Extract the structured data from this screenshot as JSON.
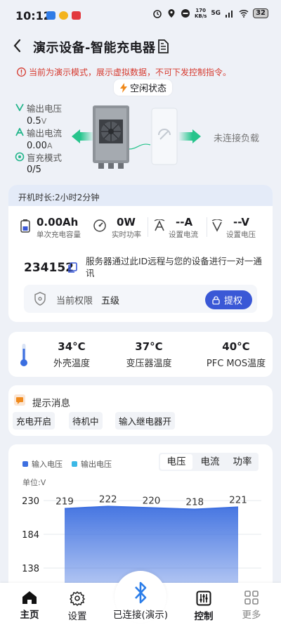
{
  "status_bar": {
    "time": "10:12",
    "net_speed": "170",
    "net_unit": "KB/s",
    "net_type": "5G",
    "battery": "32"
  },
  "header": {
    "title": "演示设备-智能充电器"
  },
  "notice": {
    "text": "当前为演示模式，展示虚拟数据，不可下发控制指令。",
    "state": "空闲状态"
  },
  "device": {
    "metrics": [
      {
        "label": "输出电压",
        "value": "0.5",
        "unit": "V"
      },
      {
        "label": "输出电流",
        "value": "0.00",
        "unit": "A"
      },
      {
        "label": "盲充模式",
        "value": "0/5",
        "unit": ""
      }
    ],
    "load_status": "未连接负载"
  },
  "info": {
    "runtime": "开机时长:2小时2分钟",
    "stats": [
      {
        "value": "0.00Ah",
        "label": "单次充电容量"
      },
      {
        "value": "0W",
        "label": "实时功率"
      },
      {
        "value": "--A",
        "label": "设置电流"
      },
      {
        "value": "--V",
        "label": "设置电压"
      }
    ],
    "device_id": "234152",
    "server_note": "服务器通过此ID远程与您的设备进行一对一通讯",
    "permission_label": "当前权限",
    "permission_level": "五级",
    "elevate_label": "提权"
  },
  "temps": [
    {
      "value": "34°C",
      "label": "外壳温度"
    },
    {
      "value": "37°C",
      "label": "变压器温度"
    },
    {
      "value": "40°C",
      "label": "PFC MOS温度"
    }
  ],
  "messages": {
    "title": "提示消息",
    "items": [
      "充电开启",
      "待机中",
      "输入继电器开"
    ]
  },
  "chart": {
    "tabs": [
      "电压",
      "电流",
      "功率"
    ],
    "active_tab": "电压",
    "unit_label": "单位:V"
  },
  "chart_data": {
    "type": "area",
    "series": [
      {
        "name": "输入电压",
        "values": [
          219,
          222,
          220,
          218,
          221
        ]
      },
      {
        "name": "输出电压",
        "values": []
      }
    ],
    "yticks": [
      230,
      184,
      138
    ],
    "ylim": [
      92,
      230
    ],
    "colors": {
      "input": "#3d6fe0",
      "output": "#3cb8e6"
    }
  },
  "nav": {
    "items": [
      "主页",
      "设置",
      "已连接(演示)",
      "控制",
      "更多"
    ]
  },
  "colors": {
    "accent": "#3a58d6",
    "danger": "#d63a2f",
    "teal": "#22b58b"
  }
}
